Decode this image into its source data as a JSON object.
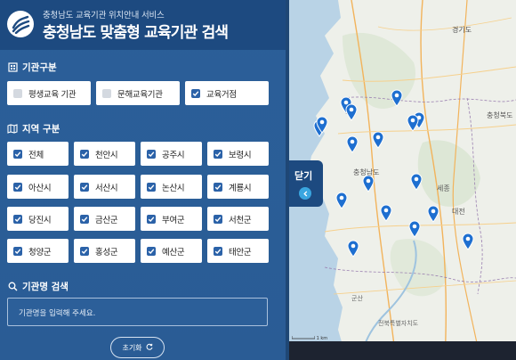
{
  "header": {
    "subtitle": "충청남도 교육기관 위치안내 서비스",
    "title": "충청남도 맞춤형 교육기관 검색"
  },
  "institution_type": {
    "heading": "기관구분",
    "items": [
      {
        "label": "평생교육 기관",
        "checked": false
      },
      {
        "label": "문해교육기관",
        "checked": false
      },
      {
        "label": "교육거점",
        "checked": true
      }
    ]
  },
  "region": {
    "heading": "지역 구분",
    "items": [
      {
        "label": "전체",
        "checked": true
      },
      {
        "label": "천안시",
        "checked": true
      },
      {
        "label": "공주시",
        "checked": true
      },
      {
        "label": "보령시",
        "checked": true
      },
      {
        "label": "아산시",
        "checked": true
      },
      {
        "label": "서산시",
        "checked": true
      },
      {
        "label": "논산시",
        "checked": true
      },
      {
        "label": "계룡시",
        "checked": true
      },
      {
        "label": "당진시",
        "checked": true
      },
      {
        "label": "금산군",
        "checked": true
      },
      {
        "label": "부여군",
        "checked": true
      },
      {
        "label": "서천군",
        "checked": true
      },
      {
        "label": "청양군",
        "checked": true
      },
      {
        "label": "홍성군",
        "checked": true
      },
      {
        "label": "예산군",
        "checked": true
      },
      {
        "label": "태안군",
        "checked": true
      }
    ]
  },
  "search": {
    "heading": "기관명 검색",
    "placeholder": "기관명을 입력해 주세요."
  },
  "reset": {
    "label": "초기화"
  },
  "map": {
    "close_label": "닫기",
    "labels": {
      "gyeonggi": "경기도",
      "chungbuk": "충청북도",
      "chungnam": "충청남도",
      "sejong": "세종",
      "daejeon": "대전",
      "jeonbuk": "전북특별자치도",
      "gunsan": "군산",
      "dangjin": "당진"
    },
    "scale": "1 km"
  },
  "colors": {
    "panel": "#2b5f99",
    "header": "#1d4a80",
    "checkbox_on": "#2b62a8",
    "pin": "#1e6fd0"
  }
}
